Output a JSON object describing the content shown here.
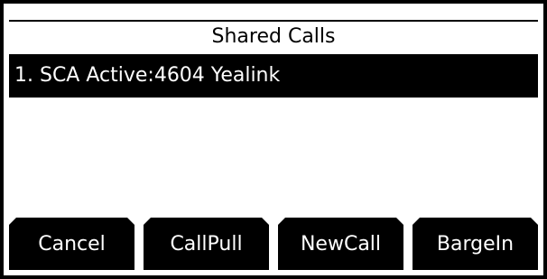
{
  "header": {
    "title": "Shared Calls"
  },
  "list": {
    "items": [
      {
        "label": "1. SCA Active:4604 Yealink"
      }
    ]
  },
  "softkeys": [
    {
      "label": "Cancel"
    },
    {
      "label": "CallPull"
    },
    {
      "label": "NewCall"
    },
    {
      "label": "BargeIn"
    }
  ]
}
